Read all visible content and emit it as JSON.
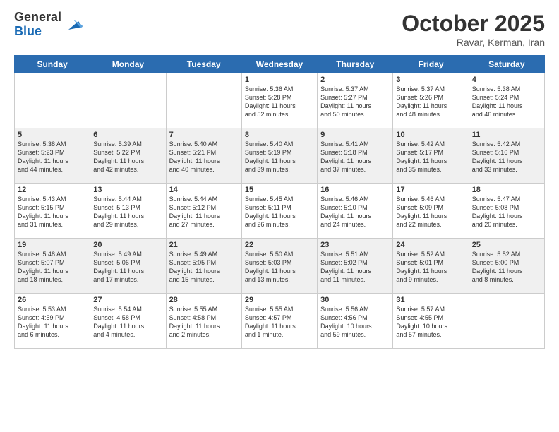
{
  "logo": {
    "general": "General",
    "blue": "Blue"
  },
  "title": "October 2025",
  "subtitle": "Ravar, Kerman, Iran",
  "headers": [
    "Sunday",
    "Monday",
    "Tuesday",
    "Wednesday",
    "Thursday",
    "Friday",
    "Saturday"
  ],
  "weeks": [
    [
      {
        "day": "",
        "info": ""
      },
      {
        "day": "",
        "info": ""
      },
      {
        "day": "",
        "info": ""
      },
      {
        "day": "1",
        "info": "Sunrise: 5:36 AM\nSunset: 5:28 PM\nDaylight: 11 hours\nand 52 minutes."
      },
      {
        "day": "2",
        "info": "Sunrise: 5:37 AM\nSunset: 5:27 PM\nDaylight: 11 hours\nand 50 minutes."
      },
      {
        "day": "3",
        "info": "Sunrise: 5:37 AM\nSunset: 5:26 PM\nDaylight: 11 hours\nand 48 minutes."
      },
      {
        "day": "4",
        "info": "Sunrise: 5:38 AM\nSunset: 5:24 PM\nDaylight: 11 hours\nand 46 minutes."
      }
    ],
    [
      {
        "day": "5",
        "info": "Sunrise: 5:38 AM\nSunset: 5:23 PM\nDaylight: 11 hours\nand 44 minutes."
      },
      {
        "day": "6",
        "info": "Sunrise: 5:39 AM\nSunset: 5:22 PM\nDaylight: 11 hours\nand 42 minutes."
      },
      {
        "day": "7",
        "info": "Sunrise: 5:40 AM\nSunset: 5:21 PM\nDaylight: 11 hours\nand 40 minutes."
      },
      {
        "day": "8",
        "info": "Sunrise: 5:40 AM\nSunset: 5:19 PM\nDaylight: 11 hours\nand 39 minutes."
      },
      {
        "day": "9",
        "info": "Sunrise: 5:41 AM\nSunset: 5:18 PM\nDaylight: 11 hours\nand 37 minutes."
      },
      {
        "day": "10",
        "info": "Sunrise: 5:42 AM\nSunset: 5:17 PM\nDaylight: 11 hours\nand 35 minutes."
      },
      {
        "day": "11",
        "info": "Sunrise: 5:42 AM\nSunset: 5:16 PM\nDaylight: 11 hours\nand 33 minutes."
      }
    ],
    [
      {
        "day": "12",
        "info": "Sunrise: 5:43 AM\nSunset: 5:15 PM\nDaylight: 11 hours\nand 31 minutes."
      },
      {
        "day": "13",
        "info": "Sunrise: 5:44 AM\nSunset: 5:13 PM\nDaylight: 11 hours\nand 29 minutes."
      },
      {
        "day": "14",
        "info": "Sunrise: 5:44 AM\nSunset: 5:12 PM\nDaylight: 11 hours\nand 27 minutes."
      },
      {
        "day": "15",
        "info": "Sunrise: 5:45 AM\nSunset: 5:11 PM\nDaylight: 11 hours\nand 26 minutes."
      },
      {
        "day": "16",
        "info": "Sunrise: 5:46 AM\nSunset: 5:10 PM\nDaylight: 11 hours\nand 24 minutes."
      },
      {
        "day": "17",
        "info": "Sunrise: 5:46 AM\nSunset: 5:09 PM\nDaylight: 11 hours\nand 22 minutes."
      },
      {
        "day": "18",
        "info": "Sunrise: 5:47 AM\nSunset: 5:08 PM\nDaylight: 11 hours\nand 20 minutes."
      }
    ],
    [
      {
        "day": "19",
        "info": "Sunrise: 5:48 AM\nSunset: 5:07 PM\nDaylight: 11 hours\nand 18 minutes."
      },
      {
        "day": "20",
        "info": "Sunrise: 5:49 AM\nSunset: 5:06 PM\nDaylight: 11 hours\nand 17 minutes."
      },
      {
        "day": "21",
        "info": "Sunrise: 5:49 AM\nSunset: 5:05 PM\nDaylight: 11 hours\nand 15 minutes."
      },
      {
        "day": "22",
        "info": "Sunrise: 5:50 AM\nSunset: 5:03 PM\nDaylight: 11 hours\nand 13 minutes."
      },
      {
        "day": "23",
        "info": "Sunrise: 5:51 AM\nSunset: 5:02 PM\nDaylight: 11 hours\nand 11 minutes."
      },
      {
        "day": "24",
        "info": "Sunrise: 5:52 AM\nSunset: 5:01 PM\nDaylight: 11 hours\nand 9 minutes."
      },
      {
        "day": "25",
        "info": "Sunrise: 5:52 AM\nSunset: 5:00 PM\nDaylight: 11 hours\nand 8 minutes."
      }
    ],
    [
      {
        "day": "26",
        "info": "Sunrise: 5:53 AM\nSunset: 4:59 PM\nDaylight: 11 hours\nand 6 minutes."
      },
      {
        "day": "27",
        "info": "Sunrise: 5:54 AM\nSunset: 4:58 PM\nDaylight: 11 hours\nand 4 minutes."
      },
      {
        "day": "28",
        "info": "Sunrise: 5:55 AM\nSunset: 4:58 PM\nDaylight: 11 hours\nand 2 minutes."
      },
      {
        "day": "29",
        "info": "Sunrise: 5:55 AM\nSunset: 4:57 PM\nDaylight: 11 hours\nand 1 minute."
      },
      {
        "day": "30",
        "info": "Sunrise: 5:56 AM\nSunset: 4:56 PM\nDaylight: 10 hours\nand 59 minutes."
      },
      {
        "day": "31",
        "info": "Sunrise: 5:57 AM\nSunset: 4:55 PM\nDaylight: 10 hours\nand 57 minutes."
      },
      {
        "day": "",
        "info": ""
      }
    ]
  ],
  "shaded_weeks": [
    1,
    3
  ],
  "colors": {
    "header_bg": "#2b6cb0",
    "shaded_row": "#f0f0f0"
  }
}
